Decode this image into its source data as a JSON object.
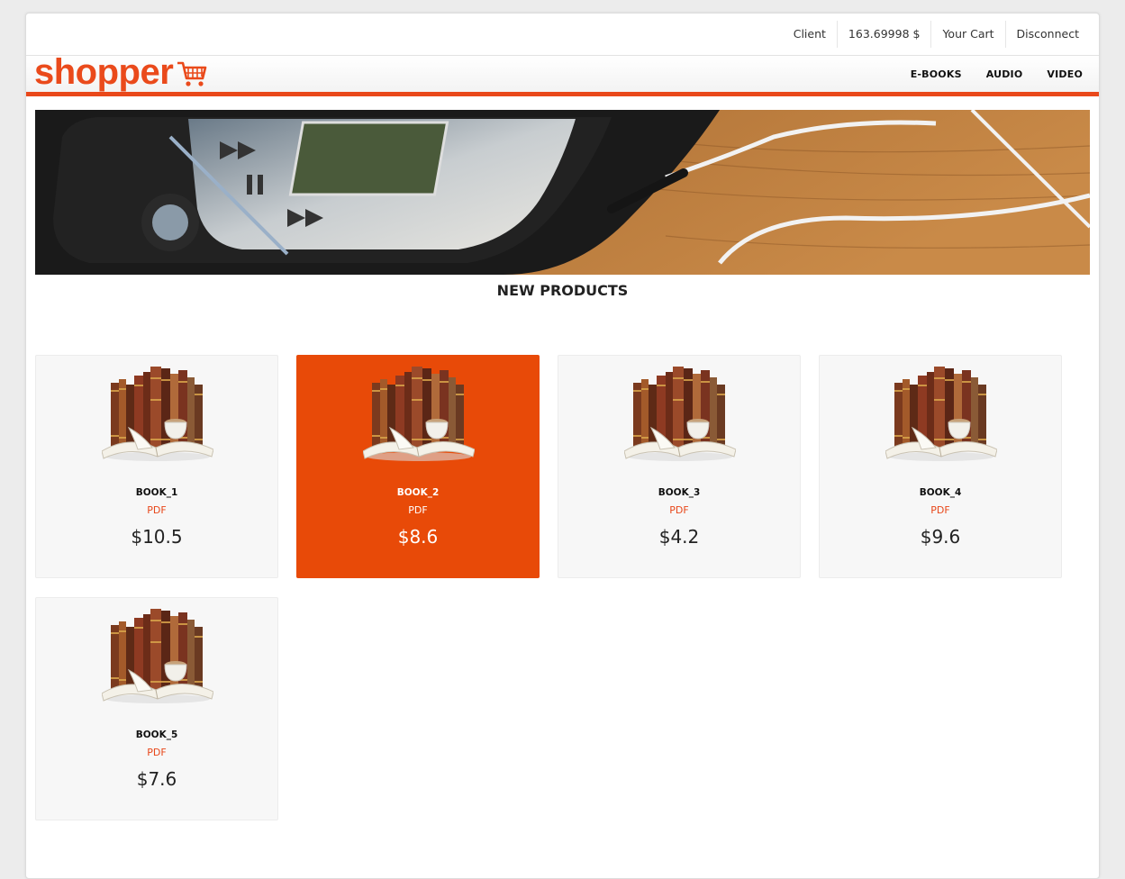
{
  "header": {
    "client_label": "Client",
    "balance": "163.69998 $",
    "cart_label": "Your Cart",
    "disconnect_label": "Disconnect"
  },
  "brand": {
    "logo_text": "shopper",
    "accent": "#e9481a"
  },
  "nav": {
    "ebooks": "E-BOOKS",
    "audio": "AUDIO",
    "video": "VIDEO"
  },
  "section_title": "NEW PRODUCTS",
  "products": [
    {
      "name": "BOOK_1",
      "format": "PDF",
      "price": "$10.5"
    },
    {
      "name": "BOOK_2",
      "format": "PDF",
      "price": "$8.6"
    },
    {
      "name": "BOOK_3",
      "format": "PDF",
      "price": "$4.2"
    },
    {
      "name": "BOOK_4",
      "format": "PDF",
      "price": "$9.6"
    },
    {
      "name": "BOOK_5",
      "format": "PDF",
      "price": "$7.6"
    }
  ],
  "icons": {
    "cart": "shopping-cart-icon"
  }
}
